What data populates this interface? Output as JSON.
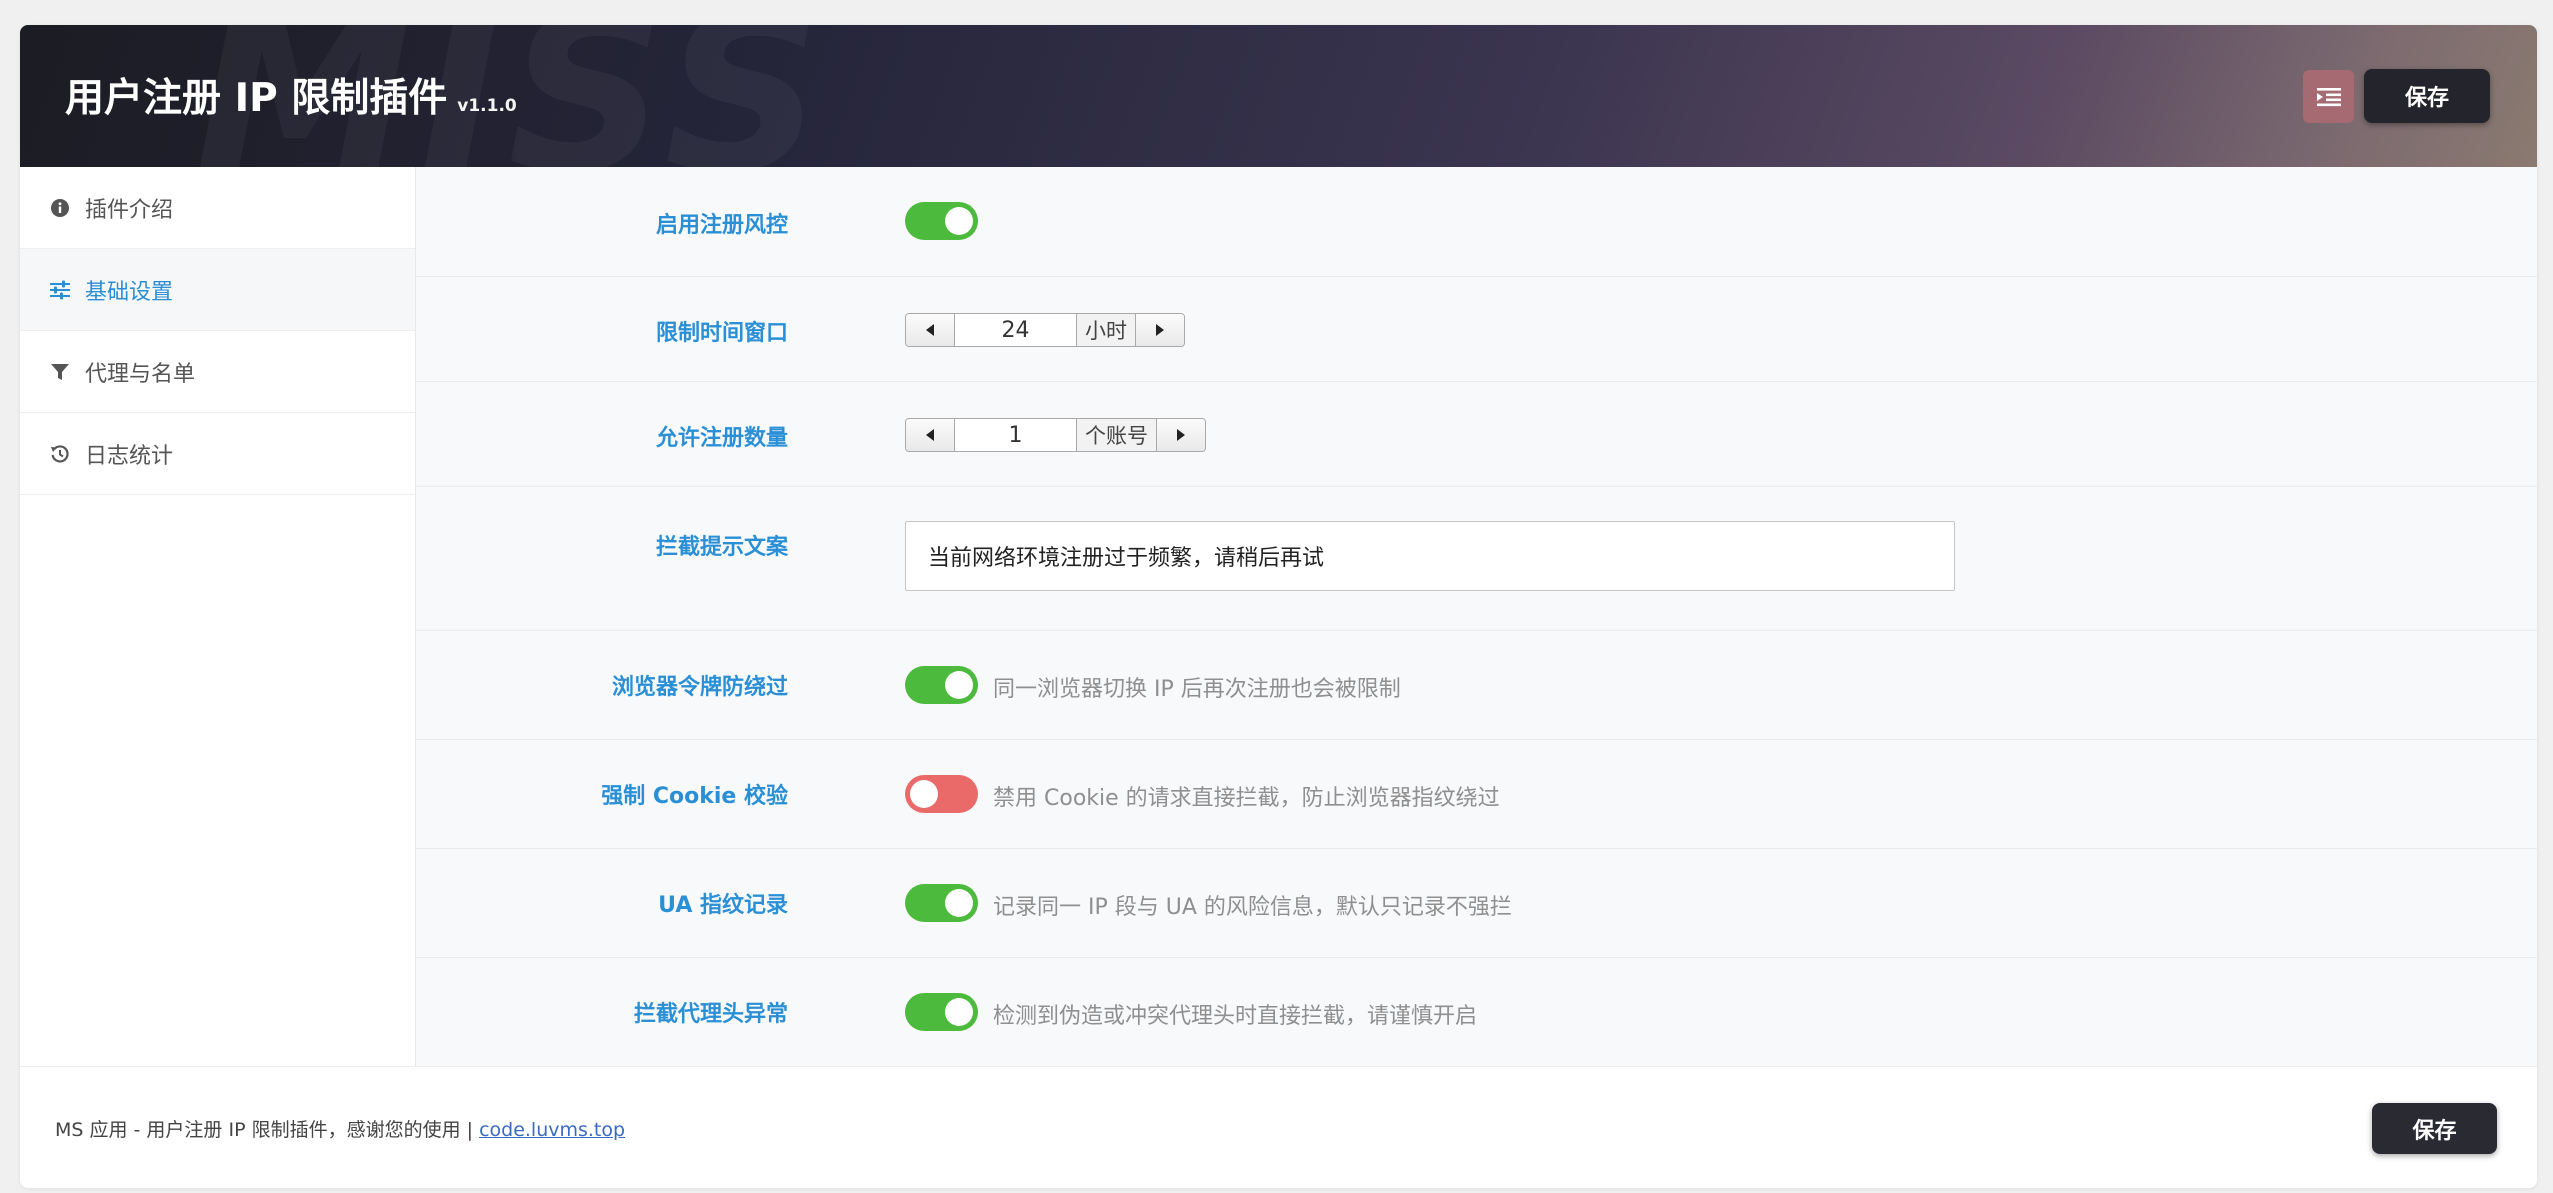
{
  "header": {
    "watermark": "MISS",
    "title": "用户注册 IP 限制插件",
    "version": "v1.1.0",
    "save_label": "保存"
  },
  "sidebar": {
    "items": [
      {
        "label": "插件介绍",
        "icon": "info-circle-icon",
        "active": false
      },
      {
        "label": "基础设置",
        "icon": "sliders-icon",
        "active": true
      },
      {
        "label": "代理与名单",
        "icon": "filter-icon",
        "active": false
      },
      {
        "label": "日志统计",
        "icon": "history-icon",
        "active": false
      }
    ]
  },
  "settings": {
    "enable_risk": {
      "label": "启用注册风控",
      "on": true
    },
    "time_window": {
      "label": "限制时间窗口",
      "value": "24",
      "unit": "小时"
    },
    "allowed_count": {
      "label": "允许注册数量",
      "value": "1",
      "unit": "个账号"
    },
    "block_message": {
      "label": "拦截提示文案",
      "value": "当前网络环境注册过于频繁，请稍后再试"
    },
    "browser_token": {
      "label": "浏览器令牌防绕过",
      "on": true,
      "desc": "同一浏览器切换 IP 后再次注册也会被限制"
    },
    "force_cookie": {
      "label": "强制 Cookie 校验",
      "on": false,
      "desc": "禁用 Cookie 的请求直接拦截，防止浏览器指纹绕过"
    },
    "ua_fingerprint": {
      "label": "UA 指纹记录",
      "on": true,
      "desc": "记录同一 IP 段与 UA 的风险信息，默认只记录不强拦"
    },
    "proxy_header": {
      "label": "拦截代理头异常",
      "on": true,
      "desc": "检测到伪造或冲突代理头时直接拦截，请谨慎开启"
    }
  },
  "footer": {
    "text": "MS 应用 - 用户注册 IP 限制插件，感谢您的使用 | ",
    "link": "code.luvms.top",
    "save_label": "保存"
  },
  "colors": {
    "accent": "#2b8fd6",
    "toggle_on": "#4cba3c",
    "toggle_off": "#ea6a6a",
    "menu_button": "#a56a72",
    "save_button": "#24242c"
  }
}
